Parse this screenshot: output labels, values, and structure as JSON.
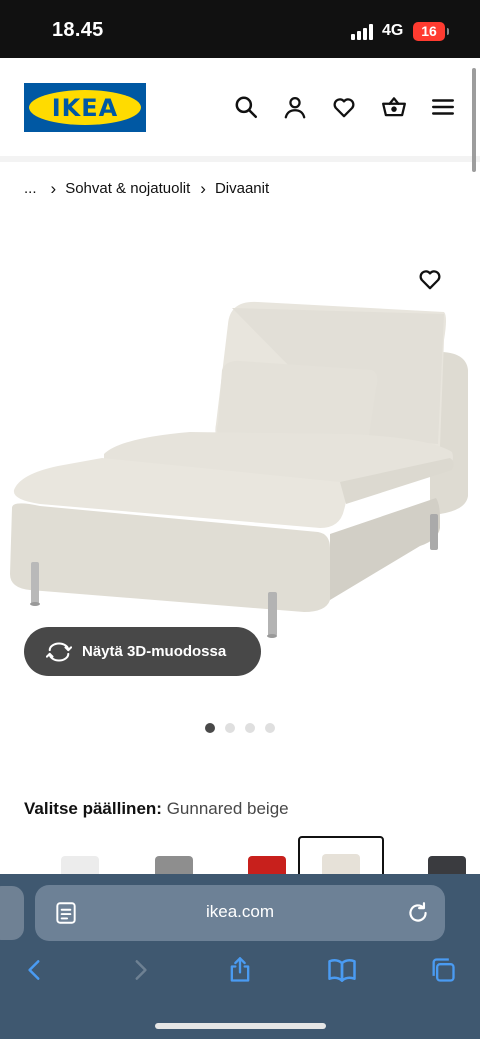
{
  "status_bar": {
    "time": "18.45",
    "network": "4G",
    "battery": "16"
  },
  "header": {
    "logo_text": "IKEA",
    "brand_colors": {
      "blue": "#0058a3",
      "yellow": "#ffdb00"
    }
  },
  "breadcrumb": {
    "ellipsis": "...",
    "items": [
      "Sohvat & nojatuolit",
      "Divaanit"
    ]
  },
  "product": {
    "view_3d_label": "Näytä 3D-muodossa",
    "carousel": {
      "total": 4,
      "active": 1
    },
    "cover_label": "Valitse päällinen:",
    "cover_value": "Gunnared beige",
    "swatch_colors": [
      "#ececec",
      "#8e8e8e",
      "#c8201c",
      "#e6e1d8",
      "#3a3b3f"
    ],
    "selected_swatch": 3
  },
  "browser": {
    "url": "ikea.com"
  },
  "colors": {
    "safari_bar": "#3f5870",
    "button_dark": "#484848"
  },
  "icons": [
    "search-icon",
    "user-icon",
    "heart-icon",
    "basket-icon",
    "menu-icon",
    "rotate-3d-icon",
    "reader-icon",
    "reload-icon",
    "back-icon",
    "forward-icon",
    "share-icon",
    "bookmarks-icon",
    "tabs-icon"
  ]
}
